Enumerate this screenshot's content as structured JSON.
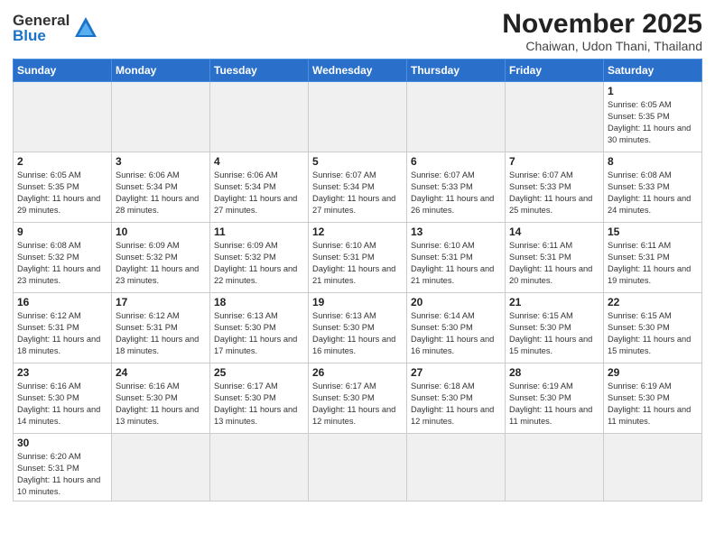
{
  "logo": {
    "general": "General",
    "blue": "Blue"
  },
  "header": {
    "month": "November 2025",
    "location": "Chaiwan, Udon Thani, Thailand"
  },
  "weekdays": [
    "Sunday",
    "Monday",
    "Tuesday",
    "Wednesday",
    "Thursday",
    "Friday",
    "Saturday"
  ],
  "weeks": [
    [
      {
        "day": "",
        "empty": true
      },
      {
        "day": "",
        "empty": true
      },
      {
        "day": "",
        "empty": true
      },
      {
        "day": "",
        "empty": true
      },
      {
        "day": "",
        "empty": true
      },
      {
        "day": "",
        "empty": true
      },
      {
        "day": "1",
        "sunrise": "6:05 AM",
        "sunset": "5:35 PM",
        "daylight": "11 hours and 30 minutes."
      }
    ],
    [
      {
        "day": "2",
        "sunrise": "6:05 AM",
        "sunset": "5:35 PM",
        "daylight": "11 hours and 29 minutes."
      },
      {
        "day": "3",
        "sunrise": "6:06 AM",
        "sunset": "5:34 PM",
        "daylight": "11 hours and 28 minutes."
      },
      {
        "day": "4",
        "sunrise": "6:06 AM",
        "sunset": "5:34 PM",
        "daylight": "11 hours and 27 minutes."
      },
      {
        "day": "5",
        "sunrise": "6:07 AM",
        "sunset": "5:34 PM",
        "daylight": "11 hours and 27 minutes."
      },
      {
        "day": "6",
        "sunrise": "6:07 AM",
        "sunset": "5:33 PM",
        "daylight": "11 hours and 26 minutes."
      },
      {
        "day": "7",
        "sunrise": "6:07 AM",
        "sunset": "5:33 PM",
        "daylight": "11 hours and 25 minutes."
      },
      {
        "day": "8",
        "sunrise": "6:08 AM",
        "sunset": "5:33 PM",
        "daylight": "11 hours and 24 minutes."
      }
    ],
    [
      {
        "day": "9",
        "sunrise": "6:08 AM",
        "sunset": "5:32 PM",
        "daylight": "11 hours and 23 minutes."
      },
      {
        "day": "10",
        "sunrise": "6:09 AM",
        "sunset": "5:32 PM",
        "daylight": "11 hours and 23 minutes."
      },
      {
        "day": "11",
        "sunrise": "6:09 AM",
        "sunset": "5:32 PM",
        "daylight": "11 hours and 22 minutes."
      },
      {
        "day": "12",
        "sunrise": "6:10 AM",
        "sunset": "5:31 PM",
        "daylight": "11 hours and 21 minutes."
      },
      {
        "day": "13",
        "sunrise": "6:10 AM",
        "sunset": "5:31 PM",
        "daylight": "11 hours and 21 minutes."
      },
      {
        "day": "14",
        "sunrise": "6:11 AM",
        "sunset": "5:31 PM",
        "daylight": "11 hours and 20 minutes."
      },
      {
        "day": "15",
        "sunrise": "6:11 AM",
        "sunset": "5:31 PM",
        "daylight": "11 hours and 19 minutes."
      }
    ],
    [
      {
        "day": "16",
        "sunrise": "6:12 AM",
        "sunset": "5:31 PM",
        "daylight": "11 hours and 18 minutes."
      },
      {
        "day": "17",
        "sunrise": "6:12 AM",
        "sunset": "5:31 PM",
        "daylight": "11 hours and 18 minutes."
      },
      {
        "day": "18",
        "sunrise": "6:13 AM",
        "sunset": "5:30 PM",
        "daylight": "11 hours and 17 minutes."
      },
      {
        "day": "19",
        "sunrise": "6:13 AM",
        "sunset": "5:30 PM",
        "daylight": "11 hours and 16 minutes."
      },
      {
        "day": "20",
        "sunrise": "6:14 AM",
        "sunset": "5:30 PM",
        "daylight": "11 hours and 16 minutes."
      },
      {
        "day": "21",
        "sunrise": "6:15 AM",
        "sunset": "5:30 PM",
        "daylight": "11 hours and 15 minutes."
      },
      {
        "day": "22",
        "sunrise": "6:15 AM",
        "sunset": "5:30 PM",
        "daylight": "11 hours and 15 minutes."
      }
    ],
    [
      {
        "day": "23",
        "sunrise": "6:16 AM",
        "sunset": "5:30 PM",
        "daylight": "11 hours and 14 minutes."
      },
      {
        "day": "24",
        "sunrise": "6:16 AM",
        "sunset": "5:30 PM",
        "daylight": "11 hours and 13 minutes."
      },
      {
        "day": "25",
        "sunrise": "6:17 AM",
        "sunset": "5:30 PM",
        "daylight": "11 hours and 13 minutes."
      },
      {
        "day": "26",
        "sunrise": "6:17 AM",
        "sunset": "5:30 PM",
        "daylight": "11 hours and 12 minutes."
      },
      {
        "day": "27",
        "sunrise": "6:18 AM",
        "sunset": "5:30 PM",
        "daylight": "11 hours and 12 minutes."
      },
      {
        "day": "28",
        "sunrise": "6:19 AM",
        "sunset": "5:30 PM",
        "daylight": "11 hours and 11 minutes."
      },
      {
        "day": "29",
        "sunrise": "6:19 AM",
        "sunset": "5:30 PM",
        "daylight": "11 hours and 11 minutes."
      }
    ],
    [
      {
        "day": "30",
        "sunrise": "6:20 AM",
        "sunset": "5:31 PM",
        "daylight": "11 hours and 10 minutes."
      },
      {
        "day": "",
        "empty": true
      },
      {
        "day": "",
        "empty": true
      },
      {
        "day": "",
        "empty": true
      },
      {
        "day": "",
        "empty": true
      },
      {
        "day": "",
        "empty": true
      },
      {
        "day": "",
        "empty": true
      }
    ]
  ],
  "labels": {
    "sunrise": "Sunrise:",
    "sunset": "Sunset:",
    "daylight": "Daylight:"
  }
}
